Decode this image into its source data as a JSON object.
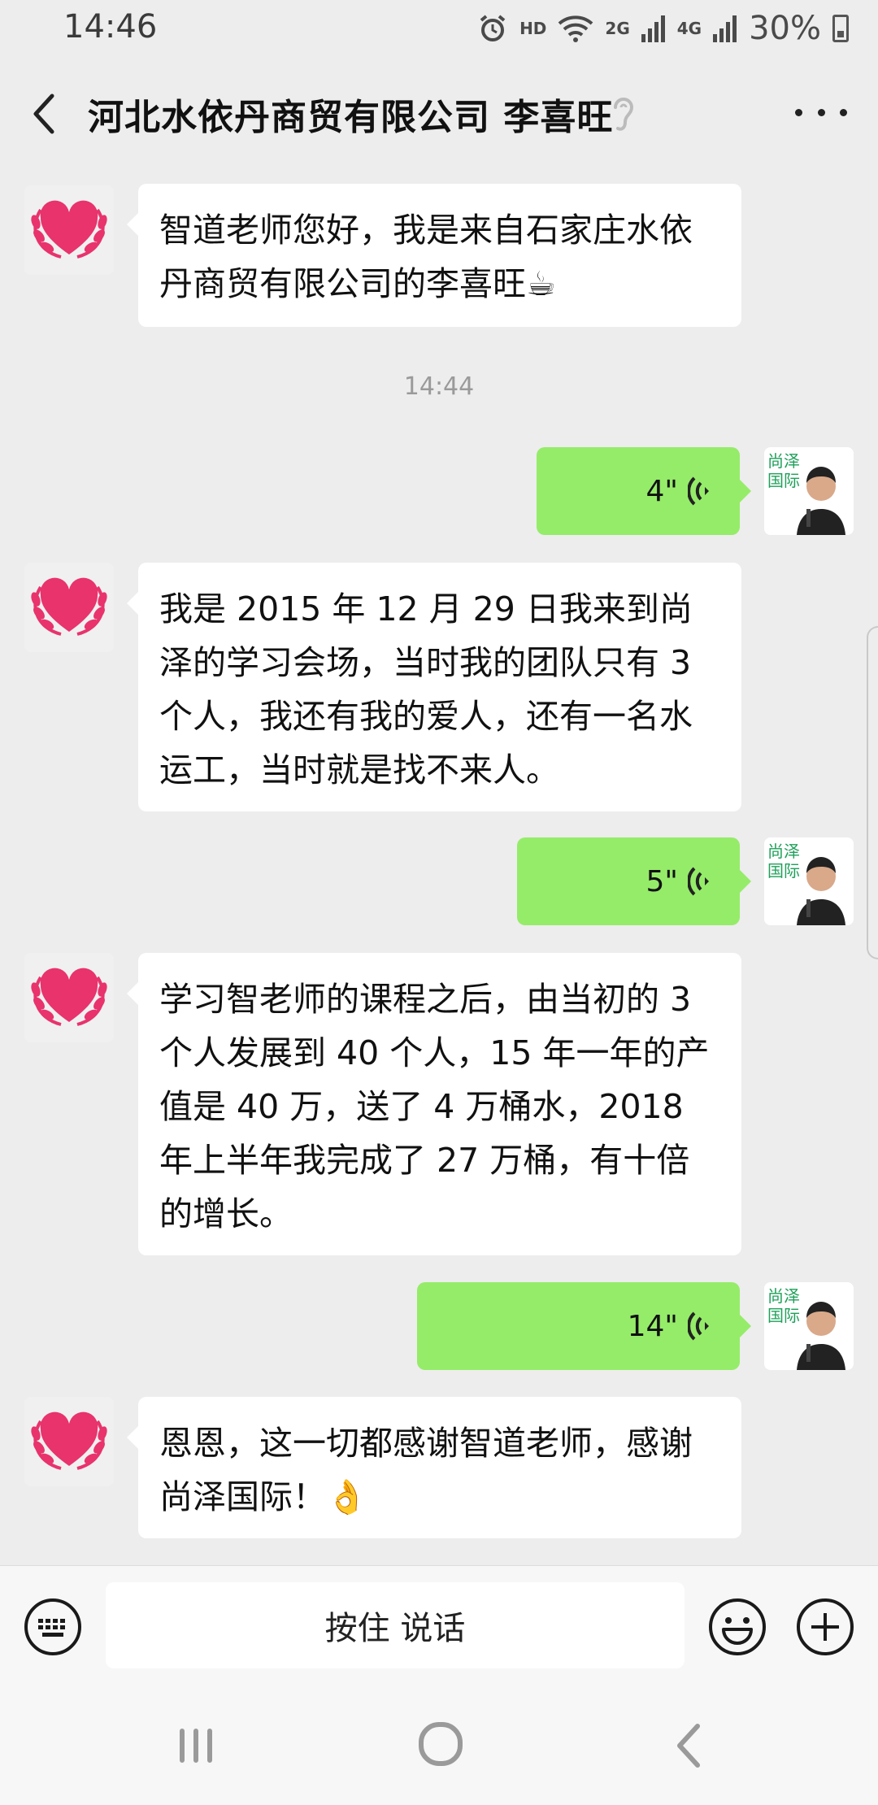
{
  "status_bar": {
    "time": "14:46",
    "hd": "HD",
    "network_2g": "2G",
    "network_4g": "4G",
    "battery": "30%"
  },
  "header": {
    "title": "河北水依丹商贸有限公司 李喜旺"
  },
  "messages": {
    "m1": "智道老师您好，我是来自石家庄水依丹商贸有限公司的李喜旺☕",
    "timestamp": "14:44",
    "v1": "4\"",
    "m2": "我是 2015 年 12 月 29 日我来到尚泽的学习会场，当时我的团队只有 3 个人，我还有我的爱人，还有一名水运工，当时就是找不来人。",
    "v2": "5\"",
    "m3": "学习智老师的课程之后，由当初的 3 个人发展到 40 个人，15 年一年的产值是 40 万，送了 4 万桶水，2018 年上半年我完成了 27 万桶，有十倍的增长。",
    "v3": "14\"",
    "m4": "恩恩，这一切都感谢智道老师，感谢尚泽国际！👌"
  },
  "avatar_teacher_logo": "尚泽国际",
  "input_bar": {
    "talk_label": "按住 说话"
  },
  "colors": {
    "sent_bubble": "#95EC69",
    "received_bubble": "#FFFFFF",
    "background": "#EDEDED",
    "heart": "#E8336D",
    "logo_green": "#1EA05A"
  }
}
